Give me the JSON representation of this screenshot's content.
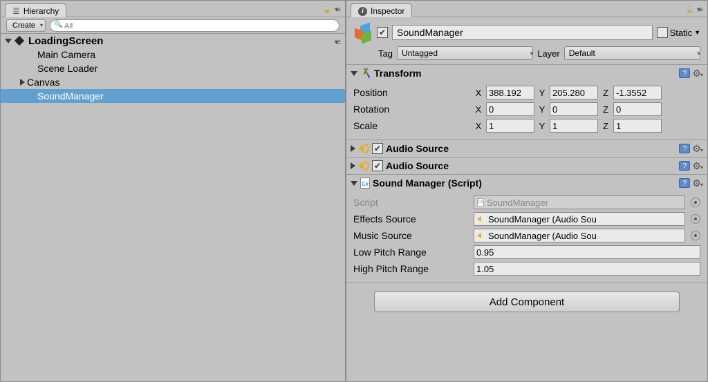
{
  "hierarchy": {
    "panel_title": "Hierarchy",
    "create_label": "Create",
    "search_value": "",
    "search_placeholder": "All",
    "root_name": "LoadingScreen",
    "items": [
      {
        "name": "Main Camera",
        "has_children": false
      },
      {
        "name": "Scene Loader",
        "has_children": false
      },
      {
        "name": "Canvas",
        "has_children": true
      },
      {
        "name": "SoundManager",
        "has_children": false,
        "selected": true
      }
    ]
  },
  "inspector": {
    "panel_title": "Inspector",
    "object_enabled": true,
    "object_name": "SoundManager",
    "static_label": "Static",
    "static_checked": false,
    "tag_label": "Tag",
    "tag_value": "Untagged",
    "layer_label": "Layer",
    "layer_value": "Default",
    "transform": {
      "title": "Transform",
      "position": {
        "label": "Position",
        "x": "388.192",
        "y": "205.280",
        "z": "-1.3552"
      },
      "rotation": {
        "label": "Rotation",
        "x": "0",
        "y": "0",
        "z": "0"
      },
      "scale": {
        "label": "Scale",
        "x": "1",
        "y": "1",
        "z": "1"
      }
    },
    "audio1": {
      "title": "Audio Source",
      "enabled": true
    },
    "audio2": {
      "title": "Audio Source",
      "enabled": true
    },
    "sound_manager": {
      "title": "Sound Manager (Script)",
      "script_label": "Script",
      "script_value": "SoundManager",
      "effects_label": "Effects Source",
      "effects_value": "SoundManager (Audio Sou",
      "music_label": "Music Source",
      "music_value": "SoundManager (Audio Sou",
      "low_pitch_label": "Low Pitch Range",
      "low_pitch_value": "0.95",
      "high_pitch_label": "High Pitch Range",
      "high_pitch_value": "1.05"
    },
    "add_component_label": "Add Component"
  }
}
